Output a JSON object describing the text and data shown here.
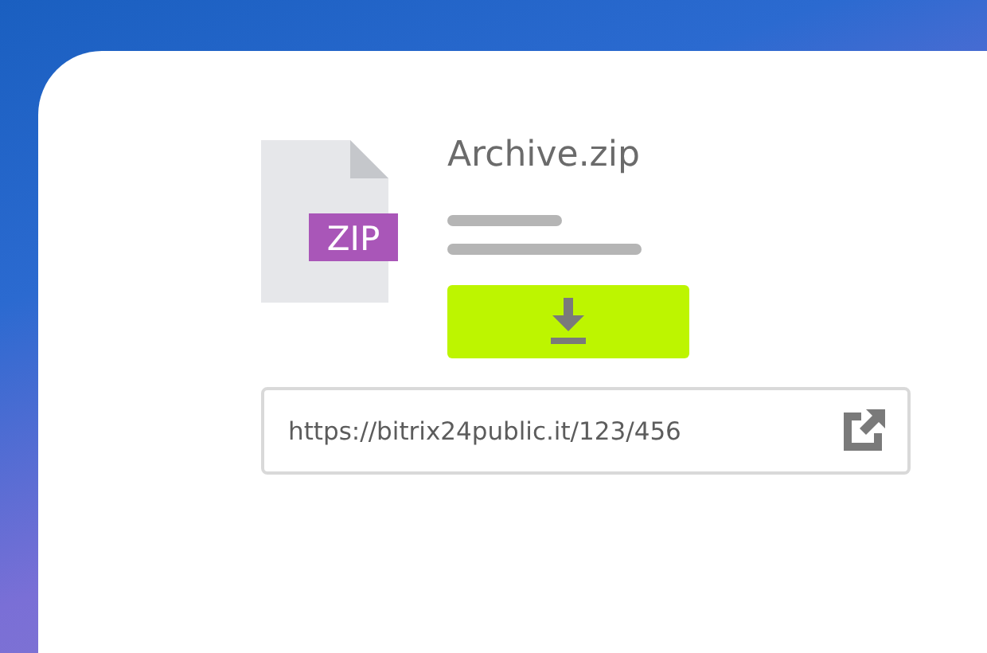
{
  "file": {
    "name": "Archive.zip",
    "type_badge": "ZIP"
  },
  "link": {
    "value": "https://bitrix24public.it/123/456"
  }
}
